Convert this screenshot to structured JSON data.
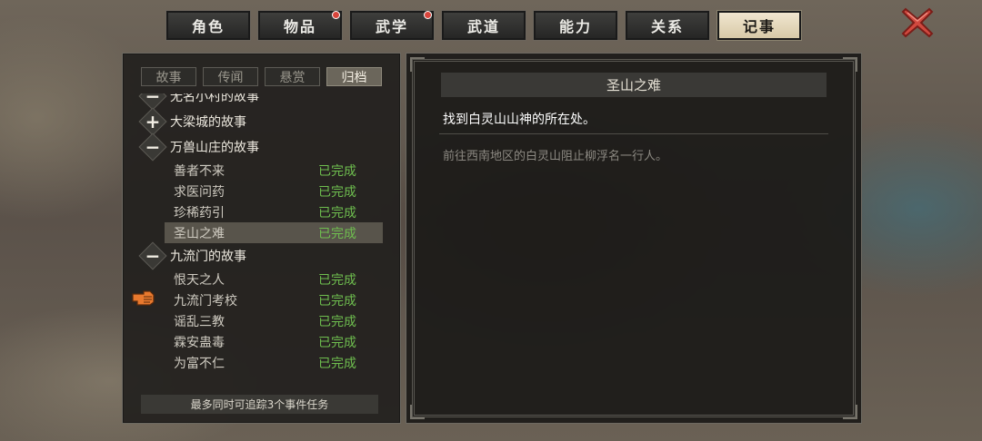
{
  "tabs": [
    {
      "label": "角色",
      "badge": false,
      "active": false
    },
    {
      "label": "物品",
      "badge": true,
      "active": false
    },
    {
      "label": "武学",
      "badge": true,
      "active": false
    },
    {
      "label": "武道",
      "badge": false,
      "active": false
    },
    {
      "label": "能力",
      "badge": false,
      "active": false
    },
    {
      "label": "关系",
      "badge": false,
      "active": false
    },
    {
      "label": "记事",
      "badge": false,
      "active": true
    }
  ],
  "close_icon": "red-x-close-icon",
  "quest_log": {
    "subtabs": [
      {
        "label": "故事",
        "active": false
      },
      {
        "label": "传闻",
        "active": false
      },
      {
        "label": "悬赏",
        "active": false
      },
      {
        "label": "归档",
        "active": true
      }
    ],
    "groups": [
      {
        "name": "无名小村的故事",
        "expanded": true,
        "quests": []
      },
      {
        "name": "大梁城的故事",
        "expanded": false,
        "quests": []
      },
      {
        "name": "万兽山庄的故事",
        "expanded": true,
        "quests": [
          {
            "name": "善者不来",
            "status": "已完成"
          },
          {
            "name": "求医问药",
            "status": "已完成"
          },
          {
            "name": "珍稀药引",
            "status": "已完成"
          },
          {
            "name": "圣山之难",
            "status": "已完成",
            "selected": true
          }
        ]
      },
      {
        "name": "九流门的故事",
        "expanded": true,
        "quests": [
          {
            "name": "恨天之人",
            "status": "已完成"
          },
          {
            "name": "九流门考校",
            "status": "已完成"
          },
          {
            "name": "谣乱三教",
            "status": "已完成"
          },
          {
            "name": "霖安蛊毒",
            "status": "已完成"
          },
          {
            "name": "为富不仁",
            "status": "已完成"
          }
        ]
      }
    ],
    "footer": "最多同时可追踪3个事件任务",
    "status_color": "#6fbf4f"
  },
  "detail": {
    "title": "圣山之难",
    "objective": "找到白灵山山神的所在处。",
    "description": "前往西南地区的白灵山阻止柳浮名一行人。"
  }
}
